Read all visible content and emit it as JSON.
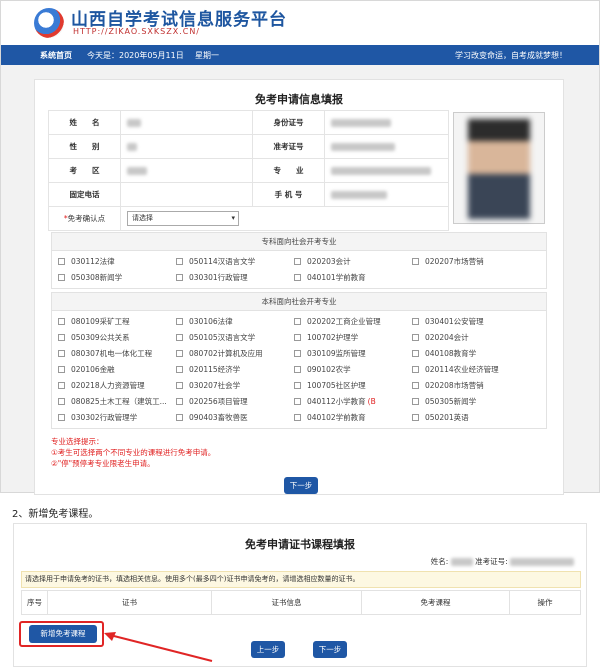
{
  "header": {
    "site_title": "山西自学考试信息服务平台",
    "site_url": "HTTP://ZIKAO.SXKSZX.CN/"
  },
  "navbar": {
    "home": "系统首页",
    "date": "今天是：2020年05月11日",
    "weekday": "星期一",
    "slogan": "学习改变命运，自考成就梦想！"
  },
  "form1": {
    "title": "免考申请信息填报",
    "labels": {
      "name": "姓　　名",
      "id": "身份证号",
      "gender": "性　　别",
      "ticket": "准考证号",
      "district": "考　　区",
      "major": "专　　业",
      "phone": "固定电话",
      "mobile": "手  机  号",
      "confirm": "免考确认点"
    },
    "required_mark": "*",
    "select_placeholder": "请选择",
    "group1_title": "专科面向社会开考专业",
    "group1_items": [
      "030112法律",
      "050114汉语言文学",
      "020203会计",
      "020207市场营销",
      "050308新闻学",
      "030301行政管理",
      "040101学前教育"
    ],
    "group2_title": "本科面向社会开考专业",
    "group2_items": [
      "080109采矿工程",
      "030106法律",
      "020202工商企业管理",
      "030401公安管理",
      "050309公共关系",
      "050105汉语言文学",
      "100702护理学",
      "020204会计",
      "080307机电一体化工程",
      "080702计算机及应用",
      "030109监所管理",
      "040108教育学",
      "020106金融",
      "020115经济学",
      "090102农学",
      "020114农业经济管理",
      "020218人力资源管理",
      "030207社会学",
      "100705社区护理",
      "020208市场营销",
      "080825土木工程（建筑工...",
      "020256项目管理",
      "040112小学教育",
      "050305新闻学",
      "030302行政管理学",
      "090403畜牧兽医",
      "040102学前教育",
      "050201英语"
    ],
    "special_mark": "(B",
    "notes_title": "专业选择提示：",
    "note1": "①考生可选择两个不同专业的课程进行免考申请。",
    "note2": "②\"停\"预停考专业限老生申请。",
    "next_button": "下一步"
  },
  "caption": "2、新增免考课程。",
  "form2": {
    "title": "免考申请证书课程填报",
    "name_label": "姓名:",
    "ticket_label": "准考证号:",
    "hint": "请选择用于申请免考的证书，填选相关信息。使用多个(最多四个)证书申请免考的，请增选相应数量的证书。",
    "columns": [
      "序号",
      "证书",
      "证书信息",
      "免考课程",
      "操作"
    ],
    "add_button": "新增免考课程",
    "prev_button": "上一步",
    "next_button": "下一步"
  },
  "colors": {
    "brand_blue": "#1f57a5",
    "alert_red": "#e02020"
  }
}
